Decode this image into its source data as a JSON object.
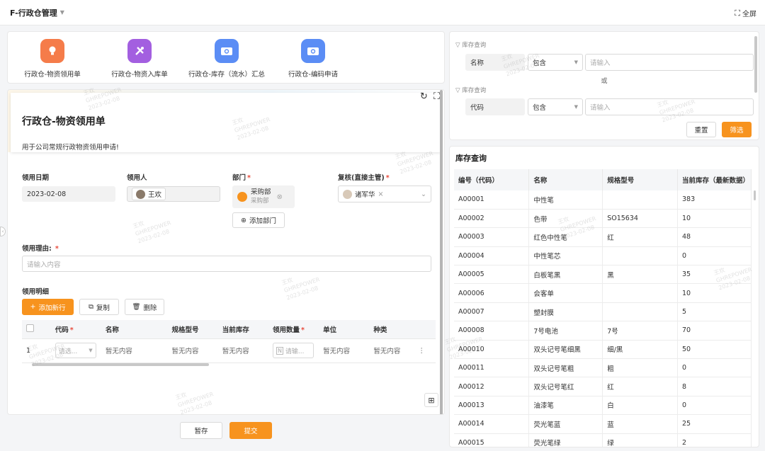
{
  "header": {
    "title": "F-行政仓管理",
    "fullscreen_label": "全屏"
  },
  "apps": [
    {
      "label": "行政仓-物资领用单",
      "color": "#f57c4a",
      "icon": "bulb-icon"
    },
    {
      "label": "行政仓-物资入库单",
      "color": "#a35fe0",
      "icon": "tools-icon"
    },
    {
      "label": "行政仓-库存（流水）汇总",
      "color": "#5b8df5",
      "icon": "camera-icon"
    },
    {
      "label": "行政仓-编码申请",
      "color": "#5b8df5",
      "icon": "camera-icon"
    }
  ],
  "form": {
    "title": "行政仓-物资领用单",
    "description": "用于公司常规行政物资领用申请!",
    "fields": {
      "date_label": "领用日期",
      "date_value": "2023-02-08",
      "user_label": "领用人",
      "user_value": "王欢",
      "dept_label": "部门",
      "dept_name": "采购部",
      "dept_sub": "采购部",
      "add_dept": "添加部门",
      "review_label": "复核(直接主管)",
      "review_value": "诸军华",
      "reason_label": "领用理由:",
      "reason_placeholder": "请输入内容"
    },
    "detail": {
      "title": "领用明细",
      "add_row": "添加新行",
      "copy": "复制",
      "delete": "删除",
      "columns": [
        "代码",
        "名称",
        "规格型号",
        "当前库存",
        "领用数量",
        "单位",
        "种类"
      ],
      "row": {
        "index": "1",
        "code_placeholder": "请选...",
        "empty": "暂无内容",
        "qty_placeholder": "请输..."
      }
    },
    "save_draft": "暂存",
    "submit": "提交"
  },
  "search": {
    "filter1_title": "库存查询",
    "filter1_field": "名称",
    "filter1_op": "包含",
    "filter1_placeholder": "请输入",
    "or_label": "或",
    "filter2_title": "库存查询",
    "filter2_field": "代码",
    "filter2_op": "包含",
    "filter2_placeholder": "请输入",
    "reset": "重置",
    "filter": "筛选"
  },
  "inventory": {
    "title": "库存查询",
    "columns": [
      "编号（代码）",
      "名称",
      "规格型号",
      "当前库存（最新数据）"
    ],
    "rows": [
      [
        "A00001",
        "中性笔",
        "",
        "383"
      ],
      [
        "A00002",
        "色带",
        "SO15634",
        "10"
      ],
      [
        "A00003",
        "红色中性笔",
        "红",
        "48"
      ],
      [
        "A00004",
        "中性笔芯",
        "",
        "0"
      ],
      [
        "A00005",
        "白板笔黑",
        "黑",
        "35"
      ],
      [
        "A00006",
        "会客单",
        "",
        "10"
      ],
      [
        "A00007",
        "塑封膜",
        "",
        "5"
      ],
      [
        "A00008",
        "7号电池",
        "7号",
        "70"
      ],
      [
        "A00010",
        "双头记号笔细黑",
        "细/黑",
        "50"
      ],
      [
        "A00011",
        "双头记号笔粗",
        "粗",
        "0"
      ],
      [
        "A00012",
        "双头记号笔红",
        "红",
        "8"
      ],
      [
        "A00013",
        "油漆笔",
        "白",
        "0"
      ],
      [
        "A00014",
        "荧光笔蓝",
        "蓝",
        "25"
      ],
      [
        "A00015",
        "荧光笔绿",
        "绿",
        "2"
      ]
    ]
  },
  "watermark": {
    "name": "王欢",
    "company": "GHREPOWER",
    "date": "2023-02-08"
  }
}
